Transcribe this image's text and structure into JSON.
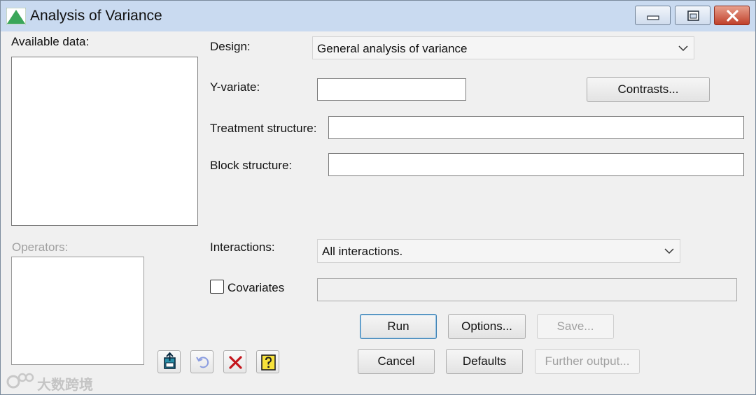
{
  "window": {
    "title": "Analysis of Variance",
    "icon": "green-triangle-icon",
    "caption_buttons": [
      "minimize-icon",
      "maximize-icon",
      "close-icon"
    ]
  },
  "left": {
    "available_data_label": "Available data:",
    "operators_label": "Operators:"
  },
  "form": {
    "design_label": "Design:",
    "design_value": "General analysis of variance",
    "yvariate_label": "Y-variate:",
    "yvariate_value": "",
    "contrasts_button": "Contrasts...",
    "treatment_label": "Treatment structure:",
    "treatment_value": "",
    "block_label": "Block structure:",
    "block_value": "",
    "interactions_label": "Interactions:",
    "interactions_value": "All interactions.",
    "covariates_label": "Covariates",
    "covariates_checked": false,
    "covariates_value": ""
  },
  "buttons": {
    "run": "Run",
    "options": "Options...",
    "save": "Save...",
    "cancel": "Cancel",
    "defaults": "Defaults",
    "further_output": "Further output..."
  },
  "toolbar_icons": [
    "transfer-icon",
    "undo-icon",
    "clear-x-icon",
    "help-icon"
  ],
  "watermark": {
    "text": "大数跨境",
    "icon": "watermark-logo-icon"
  },
  "colors": {
    "titlebar": "#c9daf0",
    "close_button": "#c0402a",
    "default_button_border": "#3c7fb1",
    "disabled_text": "#a0a0a0"
  }
}
